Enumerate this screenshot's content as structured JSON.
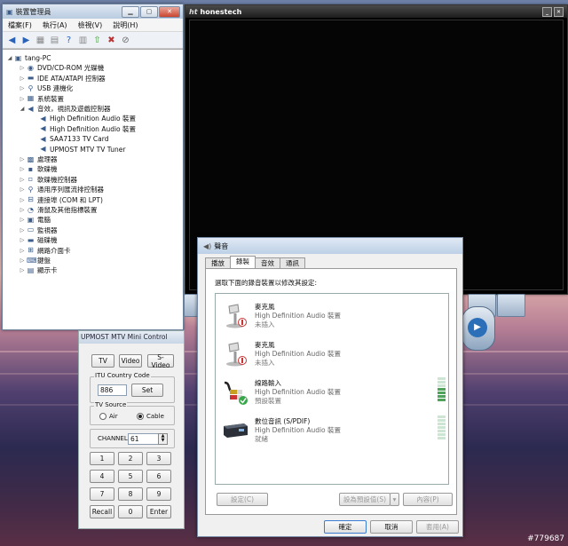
{
  "device_manager": {
    "title": "裝置管理員",
    "menu": [
      "檔案(F)",
      "執行(A)",
      "檢視(V)",
      "說明(H)"
    ],
    "toolbar_icons": [
      "back-icon",
      "forward-icon",
      "show-hide-tree-icon",
      "properties-icon",
      "help-icon",
      "view-icon",
      "update-driver-icon",
      "uninstall-icon",
      "disable-icon"
    ],
    "tree": [
      {
        "label": "tang-PC",
        "level": 0,
        "exp": "◢",
        "icon": "computer-icon"
      },
      {
        "label": "DVD/CD-ROM 光碟機",
        "level": 1,
        "exp": "▷",
        "icon": "dvd-drive-icon"
      },
      {
        "label": "IDE ATA/ATAPI 控制器",
        "level": 1,
        "exp": "▷",
        "icon": "ide-controller-icon"
      },
      {
        "label": "USB 連機化",
        "level": 1,
        "exp": "▷",
        "icon": "usb-icon"
      },
      {
        "label": "系統裝置",
        "level": 1,
        "exp": "▷",
        "icon": "system-device-icon"
      },
      {
        "label": "音效，視訊及遊戲控制器",
        "level": 1,
        "exp": "◢",
        "icon": "speaker-icon"
      },
      {
        "label": "High Definition Audio 裝置",
        "level": 2,
        "exp": "",
        "icon": "speaker-icon"
      },
      {
        "label": "High Definition Audio 裝置",
        "level": 2,
        "exp": "",
        "icon": "speaker-icon"
      },
      {
        "label": "SAA7133 TV Card",
        "level": 2,
        "exp": "",
        "icon": "speaker-icon"
      },
      {
        "label": "UPMOST MTV TV Tuner",
        "level": 2,
        "exp": "",
        "icon": "speaker-icon"
      },
      {
        "label": "處理器",
        "level": 1,
        "exp": "▷",
        "icon": "processor-icon"
      },
      {
        "label": "軟碟機",
        "level": 1,
        "exp": "▷",
        "icon": "floppy-icon"
      },
      {
        "label": "軟碟機控制器",
        "level": 1,
        "exp": "▷",
        "icon": "floppy-controller-icon"
      },
      {
        "label": "通用序列匯流排控制器",
        "level": 1,
        "exp": "▷",
        "icon": "usb-controller-icon"
      },
      {
        "label": "連接埠 (COM 和 LPT)",
        "level": 1,
        "exp": "▷",
        "icon": "port-icon"
      },
      {
        "label": "滑鼠及其他指標裝置",
        "level": 1,
        "exp": "▷",
        "icon": "mouse-icon"
      },
      {
        "label": "電腦",
        "level": 1,
        "exp": "▷",
        "icon": "computer-icon"
      },
      {
        "label": "監視器",
        "level": 1,
        "exp": "▷",
        "icon": "monitor-icon"
      },
      {
        "label": "磁碟機",
        "level": 1,
        "exp": "▷",
        "icon": "disk-drive-icon"
      },
      {
        "label": "網路介面卡",
        "level": 1,
        "exp": "▷",
        "icon": "network-adapter-icon"
      },
      {
        "label": "鍵盤",
        "level": 1,
        "exp": "▷",
        "icon": "keyboard-icon"
      },
      {
        "label": "顯示卡",
        "level": 1,
        "exp": "▷",
        "icon": "display-adapter-icon"
      }
    ]
  },
  "honestech": {
    "logo": "ht",
    "title": "honestech"
  },
  "mini_control": {
    "title": "UPMOST MTV Mini Control",
    "tv_label": "TV",
    "video_label": "Video",
    "svideo_label": "S-Video",
    "itu_group": "ITU Country Code",
    "itu_value": "886",
    "set_label": "Set",
    "source_group": "TV Source",
    "air_label": "Air",
    "cable_label": "Cable",
    "source_selected": "Cable",
    "channel_label": "CHANNEL",
    "channel_value": "61",
    "keys": [
      "1",
      "2",
      "3",
      "4",
      "5",
      "6",
      "7",
      "8",
      "9",
      "Recall",
      "0",
      "Enter"
    ]
  },
  "sound_dialog": {
    "title": "聲音",
    "tabs": [
      "播放",
      "錄製",
      "音效",
      "通訊"
    ],
    "active_tab": "錄製",
    "instruction": "選取下面的錄音裝置以修改其設定:",
    "devices": [
      {
        "name": "麥克風",
        "desc": "High Definition Audio 裝置",
        "status": "未插入",
        "icon": "microphone-icon",
        "meter": false
      },
      {
        "name": "麥克風",
        "desc": "High Definition Audio 裝置",
        "status": "未插入",
        "icon": "microphone-icon",
        "meter": false
      },
      {
        "name": "線路輸入",
        "desc": "High Definition Audio 裝置",
        "status": "預設裝置",
        "icon": "line-in-cable-icon",
        "meter": true,
        "meter_level": 0.5
      },
      {
        "name": "數位音訊 (S/PDIF)",
        "desc": "High Definition Audio 裝置",
        "status": "就緒",
        "icon": "spdif-device-icon",
        "meter": true,
        "meter_level": 0
      }
    ],
    "configure_label": "設定(C)",
    "set_default_label": "設為預設值(S)",
    "properties_label": "內容(P)",
    "ok_label": "確定",
    "cancel_label": "取消",
    "apply_label": "套用(A)"
  },
  "watermark": "#779687",
  "colors": {
    "accent": "#3b7bd0",
    "meter_on": "#4fa35b",
    "meter_off": "#cde5d3"
  }
}
